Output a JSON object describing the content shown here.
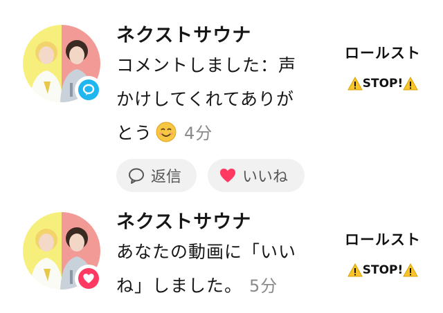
{
  "notifications": [
    {
      "type": "comment",
      "badge_icon": "comment-bubble-icon",
      "username": "ネクストサウナ",
      "message": "コメントしました：声かけしてくれてありがとう",
      "emoji": "smiling-face-icon",
      "time": "4分",
      "reply_label": "返信",
      "like_label": "いいね",
      "video_caption_line1": "ロールスト",
      "video_caption_line2": "STOP!"
    },
    {
      "type": "like",
      "badge_icon": "heart-icon",
      "username": "ネクストサウナ",
      "message": "あなたの動画に「いいね」しました。",
      "time": "5分",
      "video_caption_line1": "ロールスト",
      "video_caption_line2": "STOP!"
    }
  ],
  "colors": {
    "comment_badge": "#20b7f0",
    "like_badge": "#fe3a63",
    "pill_bg": "#f1f1f2",
    "time_text": "#8a8a8a"
  }
}
